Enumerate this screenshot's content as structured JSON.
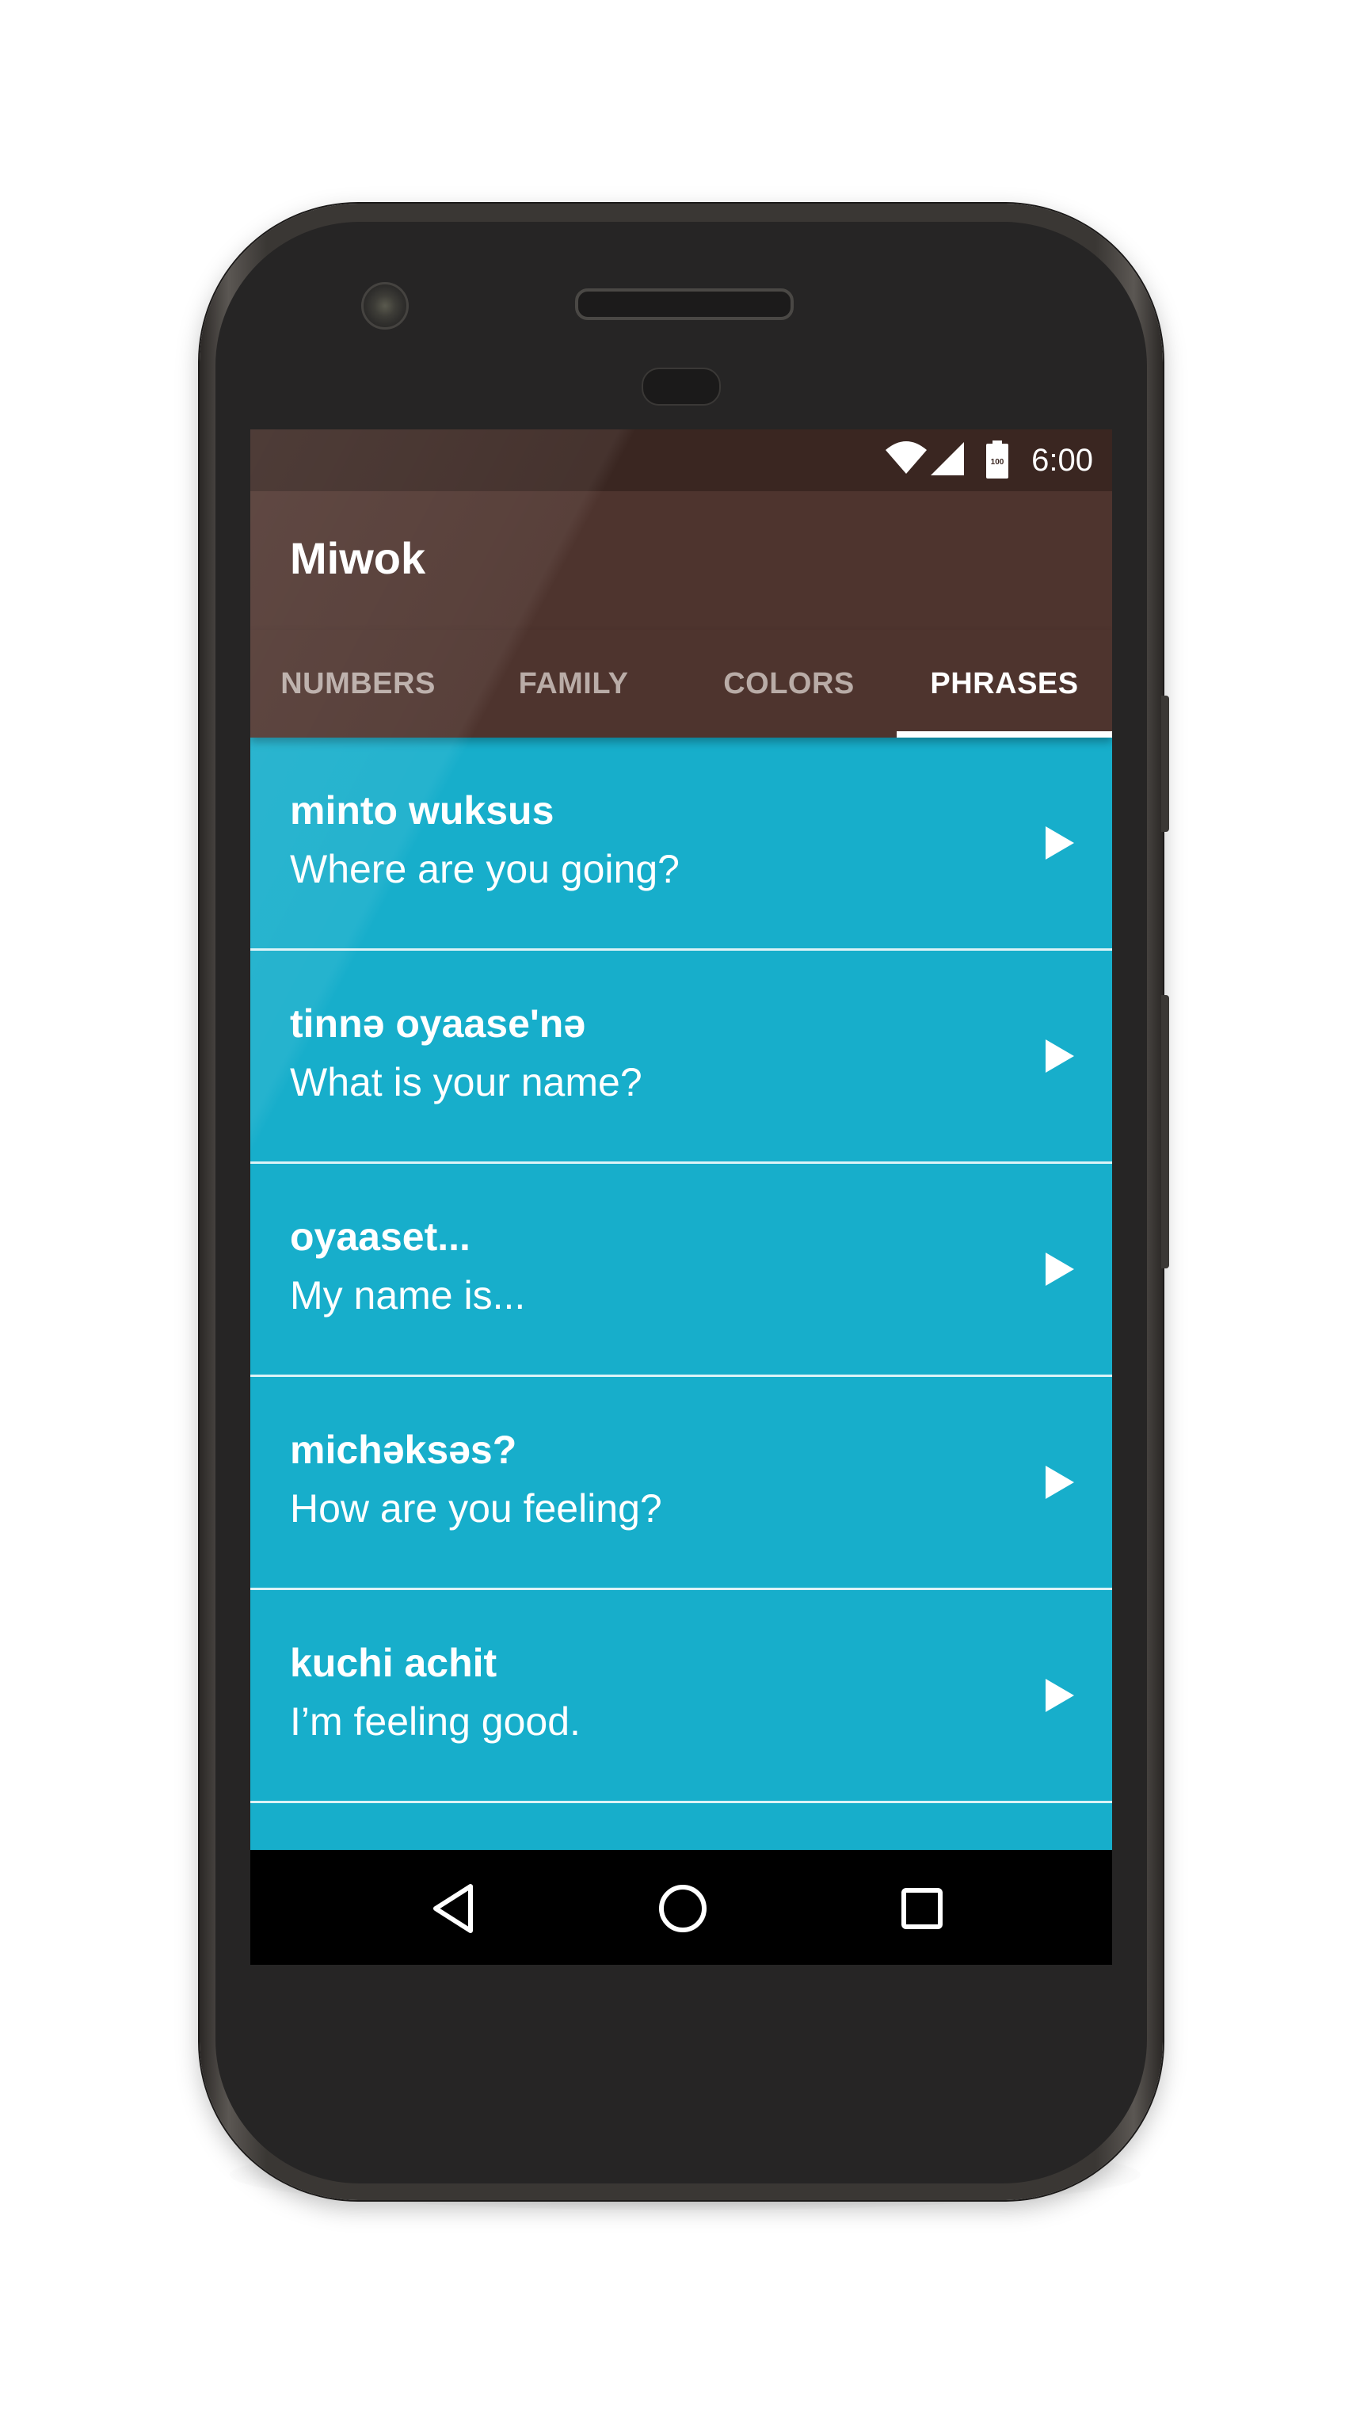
{
  "status_bar": {
    "time": "6:00",
    "battery_label": "100",
    "icons": [
      "wifi-icon",
      "cell-signal-icon",
      "battery-icon"
    ]
  },
  "app_bar": {
    "title": "Miwok"
  },
  "tabs": [
    {
      "label": "NUMBERS",
      "active": false
    },
    {
      "label": "FAMILY",
      "active": false
    },
    {
      "label": "COLORS",
      "active": false
    },
    {
      "label": "PHRASES",
      "active": true
    }
  ],
  "phrases": [
    {
      "miwok": "minto wuksus",
      "english": "Where are you going?",
      "icon": "play-icon"
    },
    {
      "miwok": "tinnə oyaase'nə",
      "english": "What is your name?",
      "icon": "play-icon"
    },
    {
      "miwok": "oyaaset...",
      "english": "My name is...",
      "icon": "play-icon"
    },
    {
      "miwok": "michəksəs?",
      "english": "How are you feeling?",
      "icon": "play-icon"
    },
    {
      "miwok": "kuchi achit",
      "english": "I’m feeling good.",
      "icon": "play-icon"
    }
  ],
  "nav_bar": {
    "buttons": [
      "back-icon",
      "home-icon",
      "recents-icon"
    ]
  },
  "colors": {
    "primary": "#4e342e",
    "primary_dark": "#3a2621",
    "list_background": "#17aecb",
    "text": "#ffffff"
  }
}
